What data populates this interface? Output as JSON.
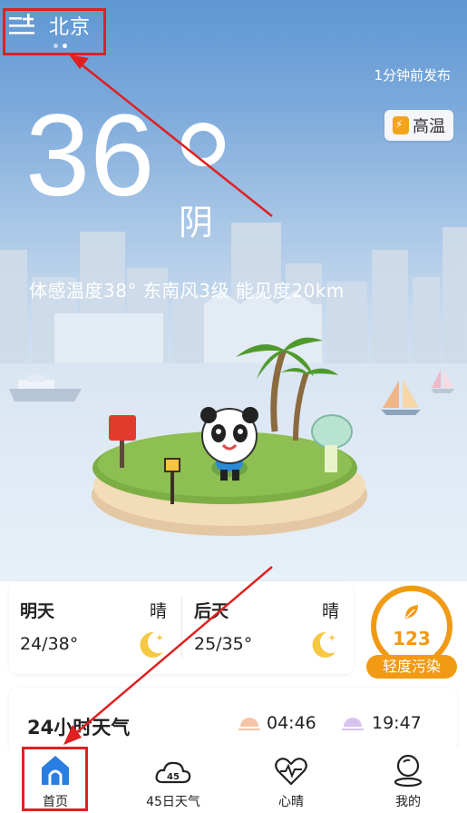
{
  "header": {
    "city": "北京",
    "publish_time": "1分钟前发布"
  },
  "current": {
    "temperature": "36",
    "condition": "阴",
    "alert_label": "高温",
    "details": "体感温度38°  东南风3级  能见度20km"
  },
  "forecast": [
    {
      "day": "明天",
      "condition": "晴",
      "temps": "24/38°"
    },
    {
      "day": "后天",
      "condition": "晴",
      "temps": "25/35°"
    }
  ],
  "aqi": {
    "value": "123",
    "level": "轻度污染"
  },
  "hourly": {
    "title": "24小时天气",
    "sunrise": "04:46",
    "sunset": "19:47"
  },
  "tabs": [
    {
      "label": "首页",
      "icon": "home-icon"
    },
    {
      "label": "45日天气",
      "icon": "cloud-45-icon",
      "badge": "45"
    },
    {
      "label": "心晴",
      "icon": "heart-pulse-icon"
    },
    {
      "label": "我的",
      "icon": "profile-icon"
    }
  ],
  "colors": {
    "accent": "#2a7de1",
    "aqi": "#f29a13",
    "annotation": "#e02020"
  }
}
